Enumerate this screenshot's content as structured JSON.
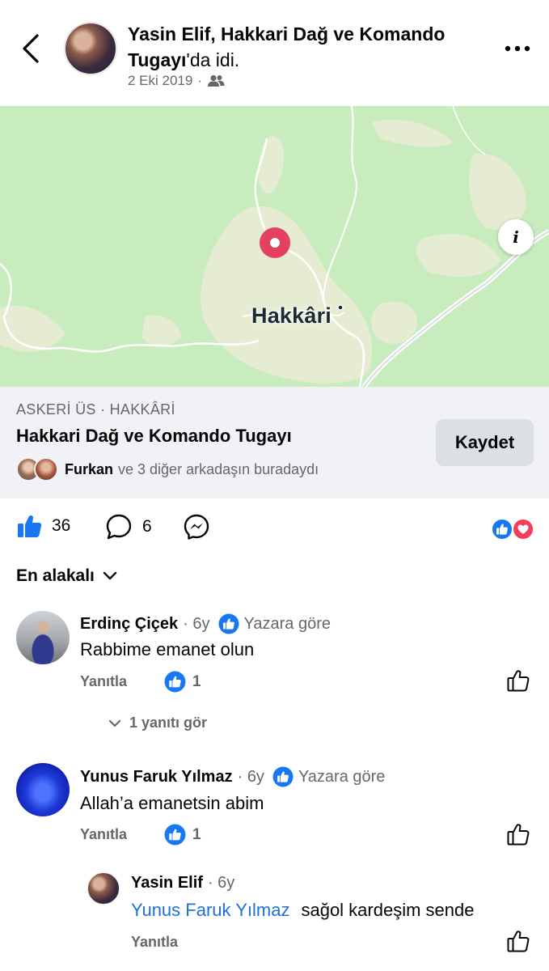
{
  "header": {
    "title_bold_1": "Yasin Elif, Hakkari Dağ ve Komando Tugayı",
    "title_plain": "'da idi.",
    "date": "2 Eki 2019",
    "separator": "·",
    "audience_icon": "friends-icon",
    "back_icon": "chevron-left-icon",
    "more_icon": "more-dots-icon"
  },
  "map": {
    "city_label": "Hakkâri",
    "info_label": "i",
    "pin_color": "#e4405f"
  },
  "place": {
    "category": "ASKERİ ÜS · HAKKÂRİ",
    "name": "Hakkari Dağ ve Komando Tugayı",
    "save_label": "Kaydet",
    "visitors_bold": "Furkan",
    "visitors_rest": "ve 3 diğer arkadaşın buradaydı"
  },
  "actions": {
    "like_count": "36",
    "comment_count": "6",
    "like_color": "#1877f2",
    "love_color": "#f33e58"
  },
  "sort": {
    "label": "En alakalı"
  },
  "comments": [
    {
      "name": "Erdinç Çiçek",
      "time": "6y",
      "badge": "Yazara göre",
      "text": "Rabbime emanet olun",
      "reply_label": "Yanıtla",
      "likes": "1",
      "view_replies": "1 yanıtı gör"
    },
    {
      "name": "Yunus Faruk Yılmaz",
      "time": "6y",
      "badge": "Yazara göre",
      "text": "Allah’a emanetsin abim",
      "reply_label": "Yanıtla",
      "likes": "1"
    }
  ],
  "reply": {
    "name": "Yasin Elif",
    "time": "6y",
    "mention": "Yunus Faruk Yılmaz",
    "text": "sağol kardeşim sende",
    "reply_label": "Yanıtla"
  }
}
